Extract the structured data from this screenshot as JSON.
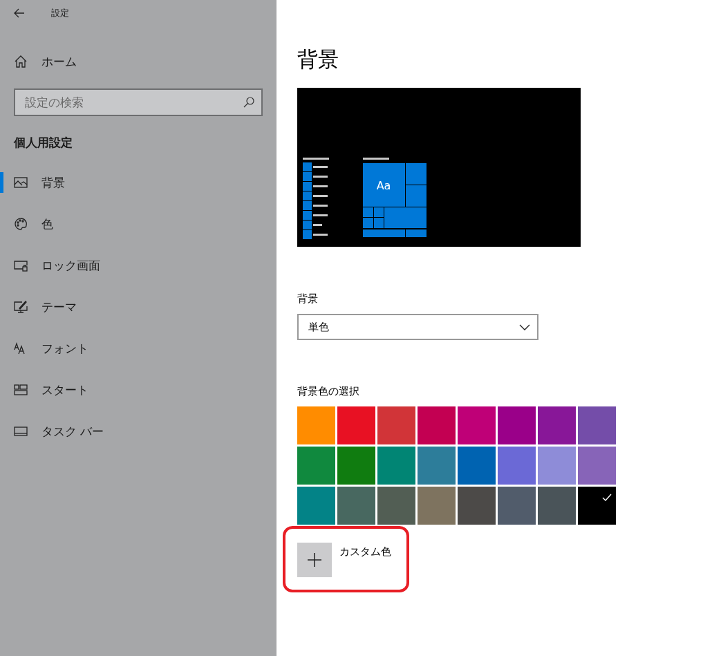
{
  "window": {
    "title": "設定"
  },
  "sidebar": {
    "home": {
      "label": "ホーム"
    },
    "search": {
      "placeholder": "設定の検索"
    },
    "section_title": "個人用設定",
    "items": [
      {
        "label": "背景",
        "kind": "picture",
        "selected": true
      },
      {
        "label": "色",
        "kind": "palette",
        "selected": false
      },
      {
        "label": "ロック画面",
        "kind": "lockscreen",
        "selected": false
      },
      {
        "label": "テーマ",
        "kind": "theme",
        "selected": false
      },
      {
        "label": "フォント",
        "kind": "font",
        "selected": false
      },
      {
        "label": "スタート",
        "kind": "start",
        "selected": false
      },
      {
        "label": "タスク バー",
        "kind": "taskbar",
        "selected": false
      }
    ]
  },
  "main": {
    "title": "背景",
    "preview": {
      "sample_text": "Aa"
    },
    "background_label": "背景",
    "background_dropdown": {
      "value": "単色"
    },
    "color_label": "背景色の選択",
    "colors": [
      {
        "color": "#ff8c00",
        "selected": false
      },
      {
        "color": "#e81123",
        "selected": false
      },
      {
        "color": "#d13438",
        "selected": false
      },
      {
        "color": "#c30052",
        "selected": false
      },
      {
        "color": "#bf0077",
        "selected": false
      },
      {
        "color": "#9a0089",
        "selected": false
      },
      {
        "color": "#881798",
        "selected": false
      },
      {
        "color": "#744da9",
        "selected": false
      },
      {
        "color": "#10893e",
        "selected": false
      },
      {
        "color": "#107c10",
        "selected": false
      },
      {
        "color": "#018574",
        "selected": false
      },
      {
        "color": "#2d7d9a",
        "selected": false
      },
      {
        "color": "#0063b1",
        "selected": false
      },
      {
        "color": "#6b69d6",
        "selected": false
      },
      {
        "color": "#8e8cd8",
        "selected": false
      },
      {
        "color": "#8764b8",
        "selected": false
      },
      {
        "color": "#038387",
        "selected": false
      },
      {
        "color": "#486860",
        "selected": false
      },
      {
        "color": "#525e54",
        "selected": false
      },
      {
        "color": "#7e735f",
        "selected": false
      },
      {
        "color": "#4c4a48",
        "selected": false
      },
      {
        "color": "#515c6b",
        "selected": false
      },
      {
        "color": "#4a5459",
        "selected": false
      },
      {
        "color": "#000000",
        "selected": true
      }
    ],
    "custom_color": {
      "label": "カスタム色"
    }
  }
}
